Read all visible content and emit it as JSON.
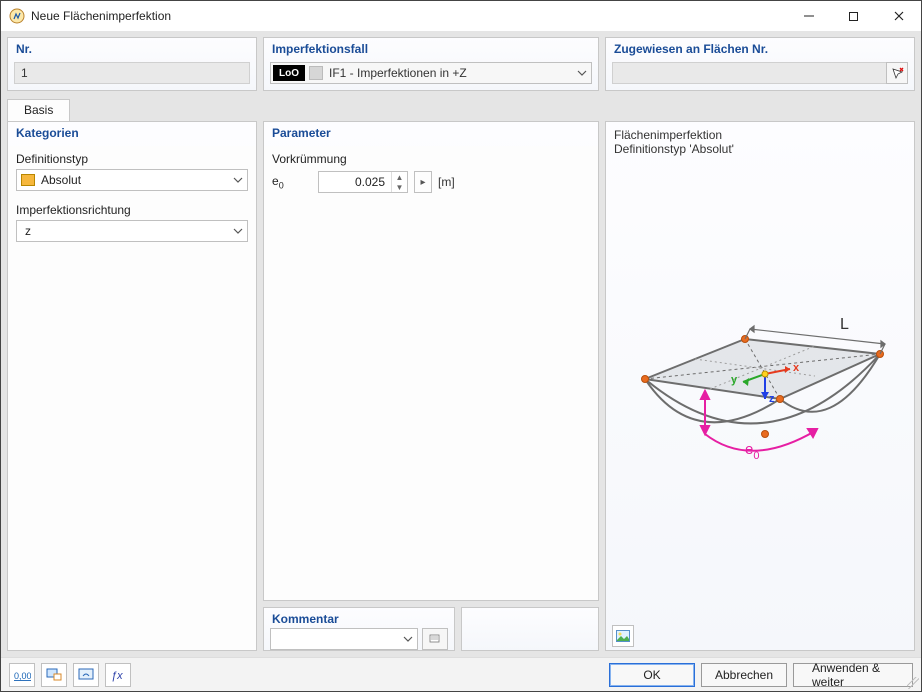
{
  "window": {
    "title": "Neue Flächenimperfektion"
  },
  "top": {
    "nr_header": "Nr.",
    "nr_value": "1",
    "if_header": "Imperfektionsfall",
    "if_badge": "LoO",
    "if_value": "IF1 - Imperfektionen in +Z",
    "zw_header": "Zugewiesen an Flächen Nr.",
    "zw_value": ""
  },
  "tabs": {
    "basis": "Basis"
  },
  "kategorien": {
    "header": "Kategorien",
    "deftyp_label": "Definitionstyp",
    "deftyp_value": "Absolut",
    "dir_label": "Imperfektionsrichtung",
    "dir_value": "z"
  },
  "parameter": {
    "header": "Parameter",
    "section": "Vorkrümmung",
    "e0_label": "e",
    "e0_sub": "0",
    "e0_value": "0.025",
    "e0_unit": "[m]"
  },
  "preview": {
    "line1": "Flächenimperfektion",
    "line2": "Definitionstyp 'Absolut'",
    "L": "L",
    "x": "x",
    "y": "y",
    "z": "z",
    "e0": "e",
    "e0_sub": "0"
  },
  "kommentar": {
    "header": "Kommentar",
    "value": ""
  },
  "buttons": {
    "ok": "OK",
    "cancel": "Abbrechen",
    "apply": "Anwenden & weiter"
  }
}
